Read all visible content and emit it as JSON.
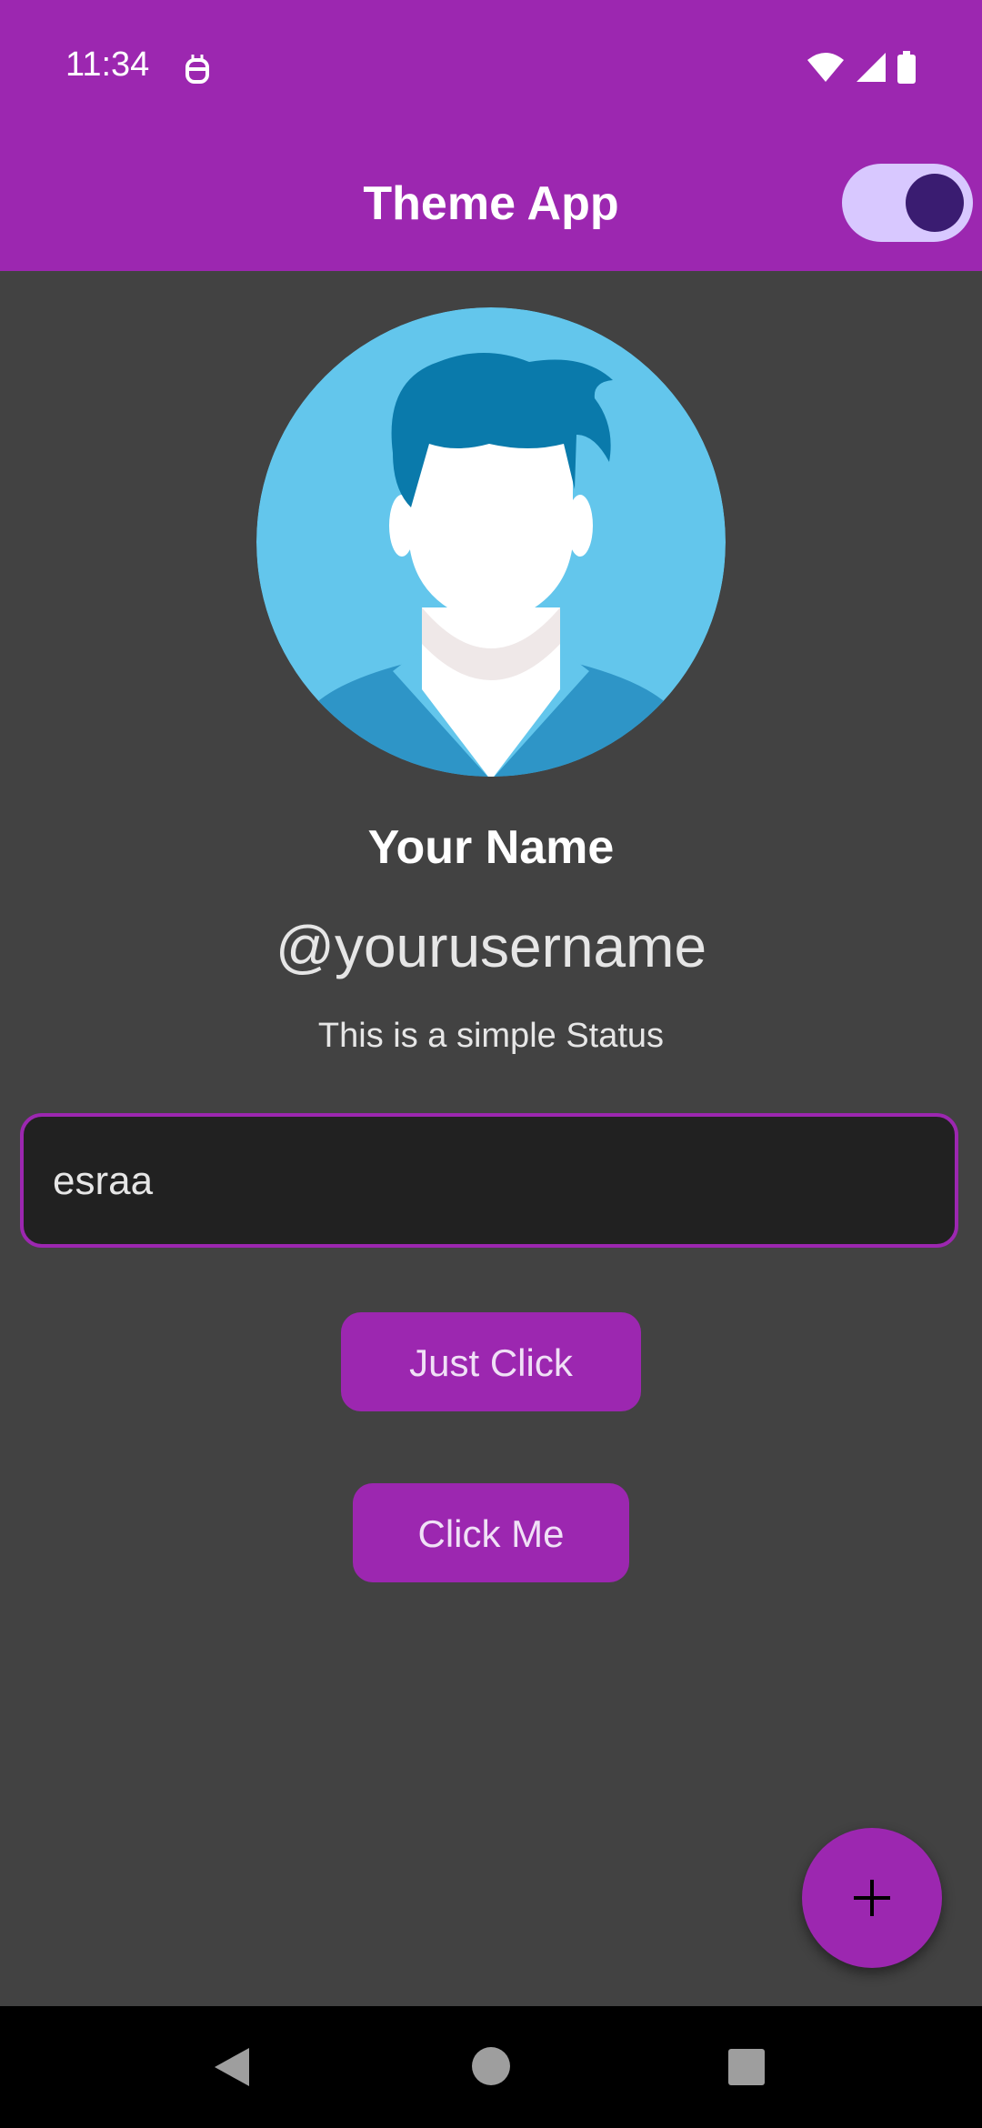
{
  "status_bar": {
    "time": "11:34",
    "icons": [
      "robot-icon",
      "wifi-icon",
      "signal-icon",
      "battery-icon"
    ]
  },
  "app_bar": {
    "title": "Theme App",
    "theme_toggle_on": true
  },
  "profile": {
    "avatar_icon": "person-avatar-icon",
    "name": "Your Name",
    "username": "@yourusername",
    "status": "This is a simple Status"
  },
  "input": {
    "value": "esraa"
  },
  "buttons": {
    "just_click": "Just Click",
    "click_me": "Click Me"
  },
  "fab": {
    "icon": "plus-icon"
  },
  "nav": {
    "icons": [
      "back-icon",
      "home-icon",
      "recents-icon"
    ]
  },
  "colors": {
    "primary": "#9C27B0",
    "background": "#424242",
    "switch_track": "#D8C8FF",
    "switch_thumb": "#3A1C71"
  }
}
